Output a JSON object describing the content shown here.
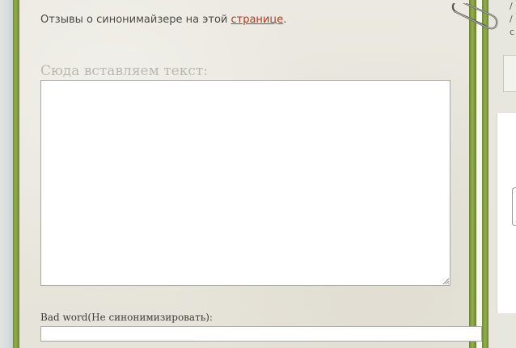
{
  "info": {
    "prefix": "Отзывы о синонимайзере на этой ",
    "link_text": "страницe",
    "suffix": "."
  },
  "main_input": {
    "label": "Сюда вставляем текст:",
    "value": ""
  },
  "bad_words": {
    "label": "Bad word(Не синонимизировать):",
    "value": ""
  },
  "side": {
    "chars": [
      "/",
      "/",
      "c"
    ]
  },
  "colors": {
    "link": "#b53a1e",
    "frame_green": "#8aa443",
    "paper": "#e9e7df"
  },
  "icons": [
    "paperclip-icon",
    "resize-grip-icon"
  ]
}
